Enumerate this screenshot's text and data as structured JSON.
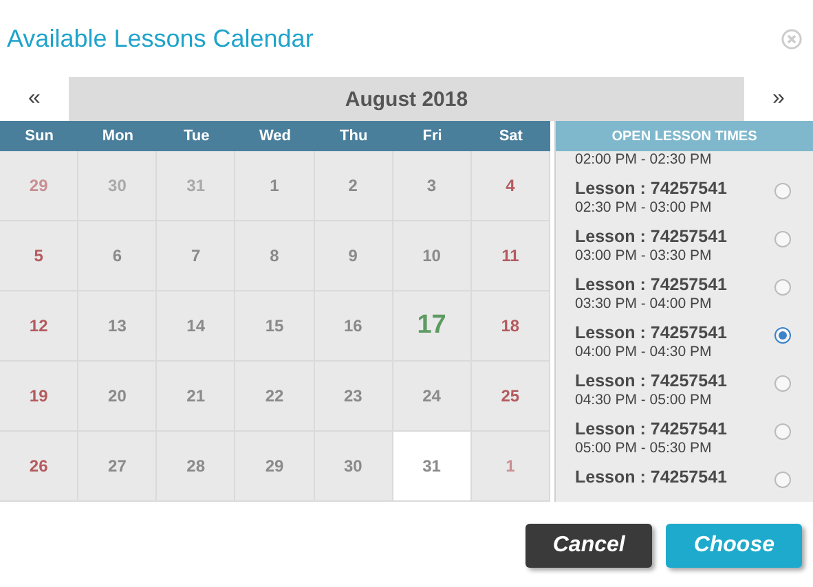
{
  "title": "Available Lessons Calendar",
  "calendar": {
    "prev": "«",
    "next": "»",
    "month": "August 2018",
    "weekdays": [
      "Sun",
      "Mon",
      "Tue",
      "Wed",
      "Thu",
      "Fri",
      "Sat"
    ],
    "weeks": [
      [
        {
          "label": "29",
          "kind": "outside",
          "selected": false
        },
        {
          "label": "30",
          "kind": "outside",
          "selected": false
        },
        {
          "label": "31",
          "kind": "outside",
          "selected": false
        },
        {
          "label": "1",
          "kind": "weekday",
          "selected": false
        },
        {
          "label": "2",
          "kind": "weekday",
          "selected": false
        },
        {
          "label": "3",
          "kind": "weekday",
          "selected": false
        },
        {
          "label": "4",
          "kind": "weekend",
          "selected": false
        }
      ],
      [
        {
          "label": "5",
          "kind": "weekend",
          "selected": false
        },
        {
          "label": "6",
          "kind": "weekday",
          "selected": false
        },
        {
          "label": "7",
          "kind": "weekday",
          "selected": false
        },
        {
          "label": "8",
          "kind": "weekday",
          "selected": false
        },
        {
          "label": "9",
          "kind": "weekday",
          "selected": false
        },
        {
          "label": "10",
          "kind": "weekday",
          "selected": false
        },
        {
          "label": "11",
          "kind": "weekend",
          "selected": false
        }
      ],
      [
        {
          "label": "12",
          "kind": "weekend",
          "selected": false
        },
        {
          "label": "13",
          "kind": "weekday",
          "selected": false
        },
        {
          "label": "14",
          "kind": "weekday",
          "selected": false
        },
        {
          "label": "15",
          "kind": "weekday",
          "selected": false
        },
        {
          "label": "16",
          "kind": "weekday",
          "selected": false
        },
        {
          "label": "17",
          "kind": "today",
          "selected": false
        },
        {
          "label": "18",
          "kind": "weekend",
          "selected": false
        }
      ],
      [
        {
          "label": "19",
          "kind": "weekend",
          "selected": false
        },
        {
          "label": "20",
          "kind": "weekday",
          "selected": false
        },
        {
          "label": "21",
          "kind": "weekday",
          "selected": false
        },
        {
          "label": "22",
          "kind": "weekday",
          "selected": false
        },
        {
          "label": "23",
          "kind": "weekday",
          "selected": false
        },
        {
          "label": "24",
          "kind": "weekday",
          "selected": false
        },
        {
          "label": "25",
          "kind": "weekend",
          "selected": false
        }
      ],
      [
        {
          "label": "26",
          "kind": "weekend",
          "selected": false
        },
        {
          "label": "27",
          "kind": "weekday",
          "selected": false
        },
        {
          "label": "28",
          "kind": "weekday",
          "selected": false
        },
        {
          "label": "29",
          "kind": "weekday",
          "selected": false
        },
        {
          "label": "30",
          "kind": "weekday",
          "selected": false
        },
        {
          "label": "31",
          "kind": "weekday",
          "selected": true
        },
        {
          "label": "1",
          "kind": "outside",
          "selected": false
        }
      ]
    ]
  },
  "lessons": {
    "heading": "OPEN LESSON TIMES",
    "items": [
      {
        "time": "02:00 PM - 02:30 PM"
      },
      {
        "title": "Lesson : 74257541",
        "time": "02:30 PM - 03:00 PM",
        "selected": false
      },
      {
        "title": "Lesson : 74257541",
        "time": "03:00 PM - 03:30 PM",
        "selected": false
      },
      {
        "title": "Lesson : 74257541",
        "time": "03:30 PM - 04:00 PM",
        "selected": false
      },
      {
        "title": "Lesson : 74257541",
        "time": "04:00 PM - 04:30 PM",
        "selected": true
      },
      {
        "title": "Lesson : 74257541",
        "time": "04:30 PM - 05:00 PM",
        "selected": false
      },
      {
        "title": "Lesson : 74257541",
        "time": "05:00 PM - 05:30 PM",
        "selected": false
      },
      {
        "title": "Lesson : 74257541",
        "selected": false
      }
    ]
  },
  "buttons": [
    {
      "label": "Cancel",
      "kind": "secondary"
    },
    {
      "label": "Choose",
      "kind": "primary"
    }
  ]
}
